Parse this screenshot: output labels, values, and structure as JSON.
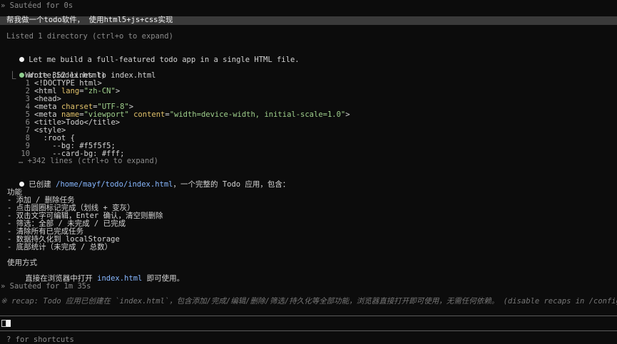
{
  "header": {
    "status_top": "» Sautéed for 0s"
  },
  "prompt": {
    "text": "帮我做一个todo软件， 使用html5+js+css实现"
  },
  "listing": {
    "text": "Listed 1 directory (ctrl+o to expand)"
  },
  "assistant_msg_1": "Let me build a full-featured todo app in a single HTML file.",
  "write_tool": {
    "title": "Write(index.html)",
    "summary": "⎿  Wrote 352 lines to index.html",
    "lines": [
      {
        "n": "1",
        "parts": [
          [
            "c-tag",
            "<!DOCTYPE html>"
          ]
        ]
      },
      {
        "n": "2",
        "parts": [
          [
            "c-tag",
            "<html "
          ],
          [
            "c-attr",
            "lang"
          ],
          [
            "c-tag",
            "="
          ],
          [
            "c-val",
            "\"zh-CN\""
          ],
          [
            "c-tag",
            ">"
          ]
        ]
      },
      {
        "n": "3",
        "parts": [
          [
            "c-tag",
            "<head>"
          ]
        ]
      },
      {
        "n": "4",
        "parts": [
          [
            "c-tag",
            "<meta "
          ],
          [
            "c-attr",
            "charset"
          ],
          [
            "c-tag",
            "="
          ],
          [
            "c-val",
            "\"UTF-8\""
          ],
          [
            "c-tag",
            ">"
          ]
        ]
      },
      {
        "n": "5",
        "parts": [
          [
            "c-tag",
            "<meta "
          ],
          [
            "c-attr",
            "name"
          ],
          [
            "c-tag",
            "="
          ],
          [
            "c-val",
            "\"viewport\""
          ],
          [
            "c-tag",
            " "
          ],
          [
            "c-attr",
            "content"
          ],
          [
            "c-tag",
            "="
          ],
          [
            "c-val",
            "\"width=device-width, initial-scale=1.0\""
          ],
          [
            "c-tag",
            ">"
          ]
        ]
      },
      {
        "n": "6",
        "parts": [
          [
            "c-tag",
            "<title>Todo</title>"
          ]
        ]
      },
      {
        "n": "7",
        "parts": [
          [
            "c-tag",
            "<style>"
          ]
        ]
      },
      {
        "n": "8",
        "parts": [
          [
            "c-tag",
            "  :root {"
          ]
        ]
      },
      {
        "n": "9",
        "parts": [
          [
            "c-tag",
            "    --bg: #f5f5f5;"
          ]
        ]
      },
      {
        "n": "10",
        "parts": [
          [
            "c-tag",
            "    --card-bg: #fff;"
          ]
        ]
      }
    ],
    "more": "… +342 lines (ctrl+o to expand)"
  },
  "assistant_msg_2": {
    "prefix": "已创建 ",
    "path": "/home/mayf/todo/index.html",
    "suffix": "，一个完整的 Todo 应用，包含："
  },
  "features": {
    "heading": "功能",
    "items": [
      "- 添加 / 删除任务",
      "- 点击圆圈标记完成（划线 + 变灰）",
      "- 双击文字可编辑，Enter 确认，清空则删除",
      "- 筛选：全部 / 未完成 / 已完成",
      "- 清除所有已完成任务",
      "- 数据持久化到 localStorage",
      "- 底部统计（未完成 / 总数）"
    ]
  },
  "usage": {
    "heading": "使用方式",
    "prefix": "直接在浏览器中打开 ",
    "file": "index.html",
    "suffix": " 即可使用。"
  },
  "status_bottom": "» Sautéed for 1m 35s",
  "recap": "※ recap: Todo 应用已创建在 `index.html`，包含添加/完成/编辑/删除/筛选/持久化等全部功能，浏览器直接打开即可使用，无需任何依赖。 (disable recaps in /config)",
  "footer": {
    "shortcuts": "? for shortcuts"
  }
}
